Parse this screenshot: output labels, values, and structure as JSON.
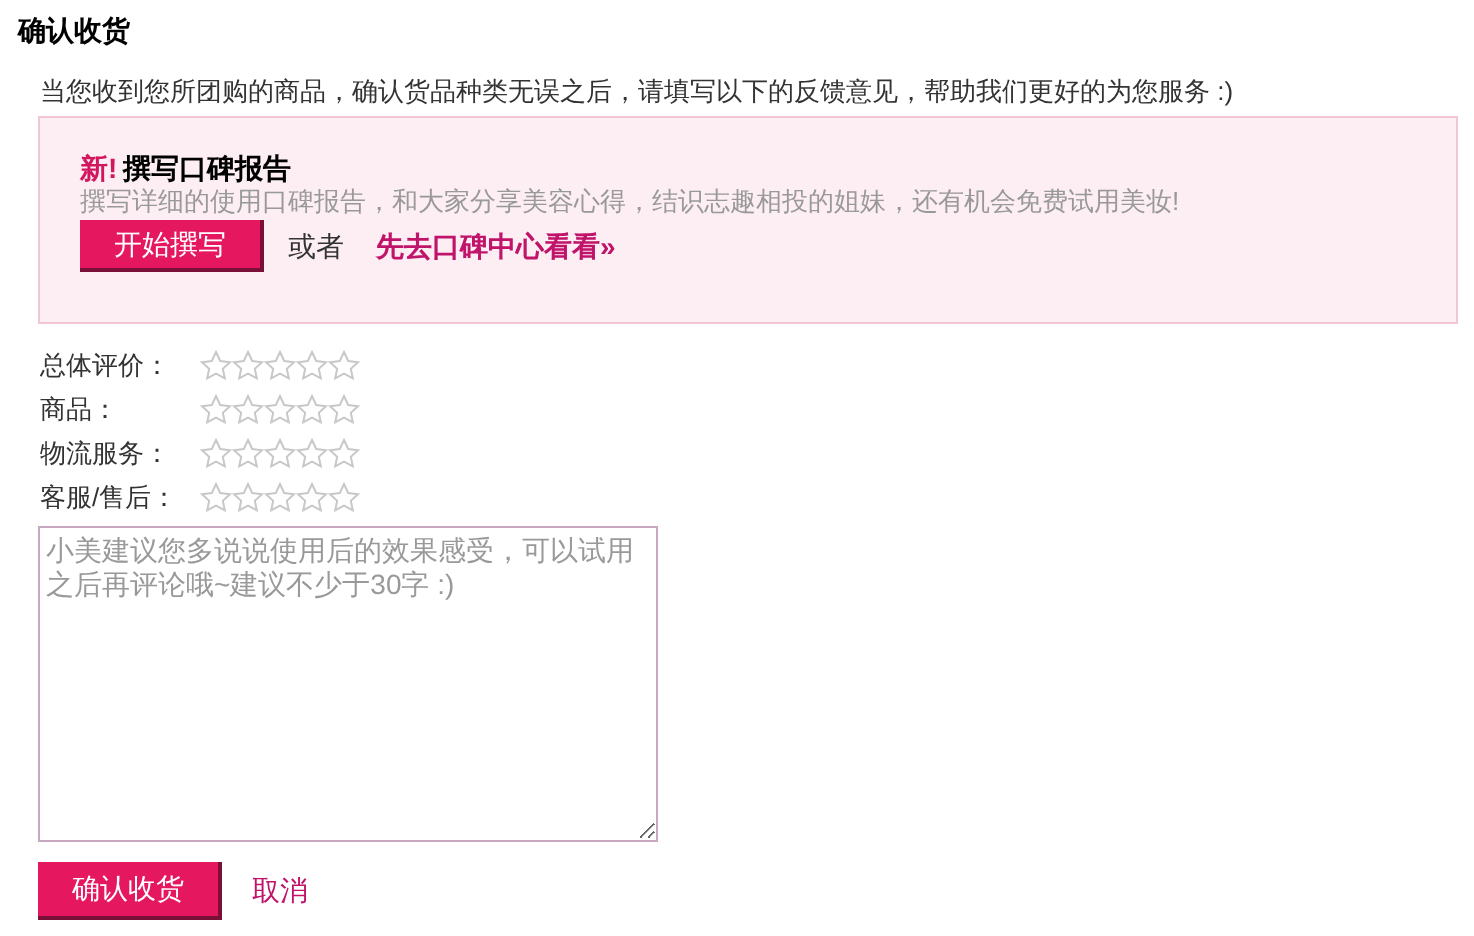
{
  "title": "确认收货",
  "intro": "当您收到您所团购的商品，确认货品种类无误之后，请填写以下的反馈意见，帮助我们更好的为您服务 :)",
  "promo": {
    "badge": "新!",
    "heading": "撰写口碑报告",
    "description": "撰写详细的使用口碑报告，和大家分享美容心得，结识志趣相投的姐妹，还有机会免费试用美妆!",
    "button": "开始撰写",
    "or": "或者",
    "link": "先去口碑中心看看»"
  },
  "ratings": [
    {
      "label": "总体评价：",
      "stars": 0
    },
    {
      "label": "商品：",
      "stars": 0
    },
    {
      "label": "物流服务：",
      "stars": 0
    },
    {
      "label": "客服/售后：",
      "stars": 0
    }
  ],
  "comment": {
    "placeholder": "小美建议您多说说使用后的效果感受，可以试用之后再评论哦~建议不少于30字 :)"
  },
  "actions": {
    "confirm": "确认收货",
    "cancel": "取消"
  }
}
